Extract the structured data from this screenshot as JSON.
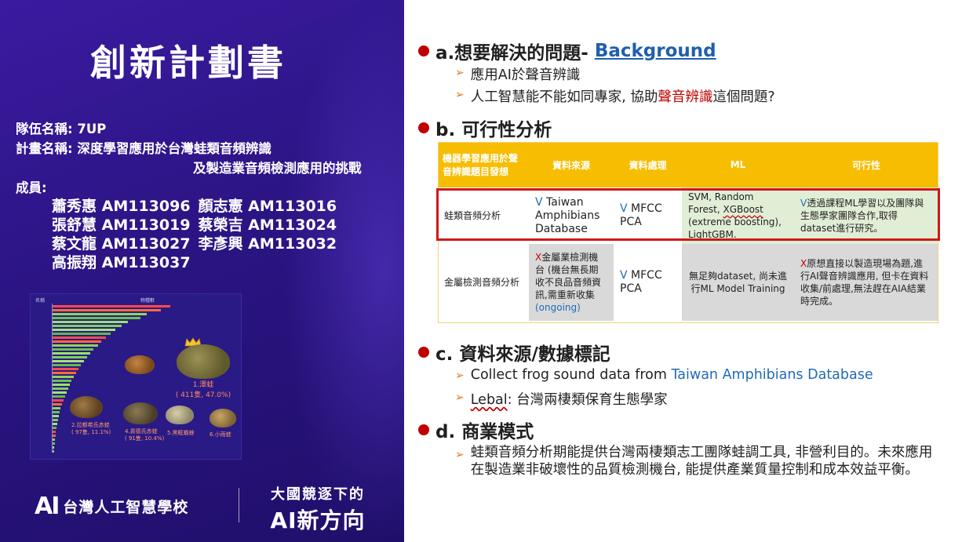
{
  "left_panel": {
    "title": "創新計劃書",
    "team_line": "隊伍名稱: 7UP",
    "project_line1": "計畫名稱: 深度學習應用於台灣蛙類音頻辨識",
    "project_line2": "及製造業音頻檢測應用的挑戰",
    "members_label": "成員:",
    "members": [
      [
        "蕭秀惠 AM113096",
        "顏志憲 AM113016"
      ],
      [
        "張舒慧 AM113019",
        "蔡榮吉 AM113024"
      ],
      [
        "蔡文龍 AM113027",
        "李彥興 AM113032"
      ],
      [
        "高振翔 AM113037",
        ""
      ]
    ],
    "chart_image": {
      "top_captions": [
        "名稱",
        "物種數"
      ],
      "frog_labels": {
        "crown": "1.澤蛙",
        "crown_detail": "( 411隻, 47.0%)",
        "f2": "2.拉都希氏赤蛙",
        "f2_detail": "( 97隻, 11.1%)",
        "f3": "4.貢德氏赤蛙",
        "f3_detail": "( 91隻, 10.4%)",
        "f4": "5.黑眶蟾蜍",
        "f5": "6.小雨蛙"
      }
    },
    "footer": {
      "logo_ai": "AI",
      "school": "台灣人工智慧學校",
      "slogan_top": "大國競逐下的",
      "slogan_bottom": "AI新方向"
    },
    "colors": {
      "bg_dark": "#200f6a",
      "bg_mid": "#2b1483"
    }
  },
  "section_a": {
    "title": "a.想要解決的問題-",
    "link": "Background",
    "bullets": [
      {
        "text": "應用AI於聲音辨識"
      },
      {
        "prefix": "人工智慧能不能如同專家, 協助",
        "highlight": "聲音辨識",
        "suffix": "這個問題?"
      }
    ]
  },
  "section_b": {
    "title": "b. 可行性分析",
    "table": {
      "headers": [
        "機器學習應用於聲音辨識題目發想",
        "資料來源",
        "資料處理",
        "ML",
        "可行性"
      ],
      "row1": {
        "topic": "蛙類音頻分析",
        "source_mark": "V",
        "source": "Taiwan Amphibians Database",
        "proc_mark": "V",
        "proc": "MFCC PCA",
        "ml_a": "SVM, Random Forest, ",
        "ml_b": "XGBoost",
        "ml_c": " (extreme boosting), LightGBM.",
        "feas_mark": "V",
        "feas": "透過課程ML學習以及團隊與生態學家團隊合作,取得dataset進行研究。"
      },
      "row2": {
        "topic": "金屬檢測音頻分析",
        "source_mark": "X",
        "source": "金屬業檢測機台 (機台無長期收不良品音頻資訊,需重新收集",
        "source_status": "(ongoing)",
        "proc_mark": "V",
        "proc": "MFCC PCA",
        "ml": "無足夠dataset, 尚未進行ML Model Training",
        "feas_mark": "X",
        "feas": "原想直接以製造現場為題,進行AI聲音辨識應用, 但卡在資料收集/前處理,無法趕在AIA結業時完成。"
      }
    }
  },
  "section_c": {
    "title": "c. 資料來源/數據標記",
    "bullet1_prefix": "Collect frog sound data from ",
    "bullet1_link": "Taiwan Amphibians Database",
    "bullet2_word": "Lebal",
    "bullet2_rest": ": 台灣兩棲類保育生態學家"
  },
  "section_d": {
    "title": "d. 商業模式",
    "bullet": "蛙類音頻分析期能提供台灣兩棲類志工團隊蛙調工具, 非營利目的。未來應用在製造業非破壞性的品質檢測機台, 能提供產業質量控制和成本效益平衡。"
  },
  "colors": {
    "bullet_dot": "#c00000",
    "arrow": "#e07a20",
    "link": "#1f5fb0",
    "table_header": "#f7bd00",
    "row1_bg": "#e1eed6",
    "row2_grey": "#d9d9d9",
    "highlight_box": "#d01818"
  },
  "icons": [
    "arrow-bullet-icon",
    "red-dot-icon",
    "ai-logo-icon"
  ]
}
